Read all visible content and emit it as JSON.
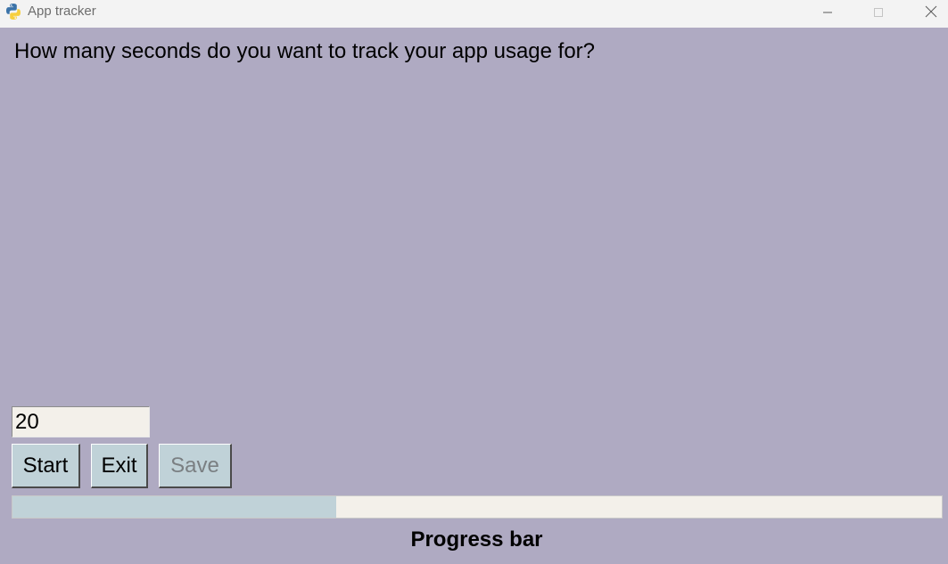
{
  "window": {
    "title": "App tracker",
    "icon": "python-icon",
    "background": "#afaac2",
    "controls": {
      "minimize": "minimize-icon",
      "maximize": "maximize-icon",
      "close": "close-icon"
    }
  },
  "main": {
    "question": "How many seconds do you want to track your app usage for?",
    "seconds_input": {
      "value": "20"
    },
    "buttons": {
      "start_label": "Start",
      "exit_label": "Exit",
      "save_label": "Save",
      "save_disabled": true
    },
    "progress": {
      "fraction": 0.348,
      "fill_color": "#c0d2d8",
      "track_color": "#f3f0ea",
      "label": "Progress bar"
    }
  }
}
